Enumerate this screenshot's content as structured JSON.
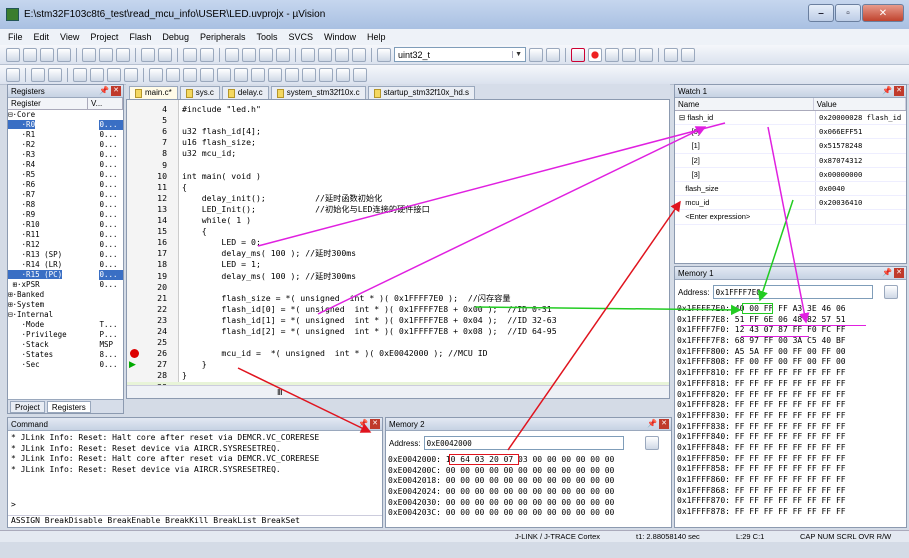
{
  "window": {
    "title": "E:\\stm32F103c8t6_test\\read_mcu_info\\USER\\LED.uvprojx - µVision",
    "min": "–",
    "max": "▫",
    "close": "✕"
  },
  "menu": [
    "File",
    "Edit",
    "View",
    "Project",
    "Flash",
    "Debug",
    "Peripherals",
    "Tools",
    "SVCS",
    "Window",
    "Help"
  ],
  "toolbar": {
    "target_combo": "uint32_t"
  },
  "registers": {
    "title": "Registers",
    "col_register": "Register",
    "col_value": "V...",
    "rows": [
      {
        "name": "⊟·Core",
        "value": ""
      },
      {
        "name": "   ·R0",
        "value": "0...",
        "sel": true
      },
      {
        "name": "   ·R1",
        "value": "0..."
      },
      {
        "name": "   ·R2",
        "value": "0..."
      },
      {
        "name": "   ·R3",
        "value": "0..."
      },
      {
        "name": "   ·R4",
        "value": "0..."
      },
      {
        "name": "   ·R5",
        "value": "0..."
      },
      {
        "name": "   ·R6",
        "value": "0..."
      },
      {
        "name": "   ·R7",
        "value": "0..."
      },
      {
        "name": "   ·R8",
        "value": "0..."
      },
      {
        "name": "   ·R9",
        "value": "0..."
      },
      {
        "name": "   ·R10",
        "value": "0..."
      },
      {
        "name": "   ·R11",
        "value": "0..."
      },
      {
        "name": "   ·R12",
        "value": "0..."
      },
      {
        "name": "   ·R13 (SP)",
        "value": "0..."
      },
      {
        "name": "   ·R14 (LR)",
        "value": "0..."
      },
      {
        "name": "   ·R15 (PC)",
        "value": "0...",
        "sel": true
      },
      {
        "name": " ⊞·xPSR",
        "value": "0..."
      },
      {
        "name": "⊞·Banked",
        "value": ""
      },
      {
        "name": "⊞·System",
        "value": ""
      },
      {
        "name": "⊟·Internal",
        "value": ""
      },
      {
        "name": "   ·Mode",
        "value": "T..."
      },
      {
        "name": "   ·Privilege",
        "value": "P..."
      },
      {
        "name": "   ·Stack",
        "value": "MSP"
      },
      {
        "name": "   ·States",
        "value": "8..."
      },
      {
        "name": "   ·Sec",
        "value": "0..."
      }
    ],
    "tab_project": "Project",
    "tab_registers": "Registers"
  },
  "editor": {
    "tabs": [
      "main.c*",
      "sys.c",
      "delay.c",
      "system_stm32f10x.c",
      "startup_stm32f10x_hd.s"
    ],
    "lines": [
      {
        "n": "4",
        "code": "#include \"led.h\""
      },
      {
        "n": "5",
        "code": ""
      },
      {
        "n": "6",
        "code": "u32 flash_id[4];"
      },
      {
        "n": "7",
        "code": "u16 flash_size;"
      },
      {
        "n": "8",
        "code": "u32 mcu_id;"
      },
      {
        "n": "9",
        "code": ""
      },
      {
        "n": "10",
        "code": "int main( void )"
      },
      {
        "n": "11",
        "code": "{"
      },
      {
        "n": "12",
        "code": "    delay_init();          //延时函数初始化"
      },
      {
        "n": "13",
        "code": "    LED_Init();            //初始化与LED连接的硬件接口"
      },
      {
        "n": "14",
        "code": "    while( 1 )"
      },
      {
        "n": "15",
        "code": "    {"
      },
      {
        "n": "16",
        "code": "        LED = 0;"
      },
      {
        "n": "17",
        "code": "        delay_ms( 100 ); //延时300ms"
      },
      {
        "n": "18",
        "code": "        LED = 1;"
      },
      {
        "n": "19",
        "code": "        delay_ms( 100 ); //延时300ms"
      },
      {
        "n": "20",
        "code": ""
      },
      {
        "n": "21",
        "code": "        flash_size = *( unsigned  int * )( 0x1FFFF7E0 );  //闪存容量"
      },
      {
        "n": "22",
        "code": "        flash_id[0] = *( unsigned  int * )( 0x1FFFF7E8 + 0x00 );  //ID 0-31"
      },
      {
        "n": "23",
        "code": "        flash_id[1] = *( unsigned  int * )( 0x1FFFF7E8 + 0x04 );  //ID 32-63"
      },
      {
        "n": "24",
        "code": "        flash_id[2] = *( unsigned  int * )( 0x1FFFF7E8 + 0x08 );  //ID 64-95"
      },
      {
        "n": "25",
        "code": ""
      },
      {
        "n": "26",
        "code": "        mcu_id =  *( unsigned  int * )( 0xE0042000 ); //MCU ID"
      },
      {
        "n": "27",
        "code": "    }"
      },
      {
        "n": "28",
        "code": "}"
      },
      {
        "n": "29",
        "code": ""
      }
    ]
  },
  "watch": {
    "title": "Watch 1",
    "col_name": "Name",
    "col_value": "Value",
    "rows": [
      {
        "name": "⊟ flash_id",
        "value": "0x20000028 flash_id"
      },
      {
        "name": "      [0]",
        "value": "0x066EFF51"
      },
      {
        "name": "      [1]",
        "value": "0x51578248"
      },
      {
        "name": "      [2]",
        "value": "0x87074312"
      },
      {
        "name": "      [3]",
        "value": "0x00000000"
      },
      {
        "name": "   flash_size",
        "value": "0x0040"
      },
      {
        "name": "   mcu_id",
        "value": "0x20036410"
      },
      {
        "name": "   <Enter expression>",
        "value": ""
      }
    ]
  },
  "memory1": {
    "title": "Memory 1",
    "addr_label": "Address:",
    "addr": "0x1FFFF7E0",
    "rows": [
      "0x1FFFF7E0: 40 00 FF FF A3 3E 46 06",
      "0x1FFFF7E8: 51 FF 6E 06 48 82 57 51",
      "0x1FFFF7F0: 12 43 07 87 FF F0 FC FF",
      "0x1FFFF7F8: 68 97 FF 00 3A C5 40 BF",
      "0x1FFFF800: A5 5A FF 00 FF 00 FF 00",
      "0x1FFFF808: FF 00 FF 00 FF 00 FF 00",
      "0x1FFFF810: FF FF FF FF FF FF FF FF",
      "0x1FFFF818: FF FF FF FF FF FF FF FF",
      "0x1FFFF820: FF FF FF FF FF FF FF FF",
      "0x1FFFF828: FF FF FF FF FF FF FF FF",
      "0x1FFFF830: FF FF FF FF FF FF FF FF",
      "0x1FFFF838: FF FF FF FF FF FF FF FF",
      "0x1FFFF840: FF FF FF FF FF FF FF FF",
      "0x1FFFF848: FF FF FF FF FF FF FF FF",
      "0x1FFFF850: FF FF FF FF FF FF FF FF",
      "0x1FFFF858: FF FF FF FF FF FF FF FF",
      "0x1FFFF860: FF FF FF FF FF FF FF FF",
      "0x1FFFF868: FF FF FF FF FF FF FF FF",
      "0x1FFFF870: FF FF FF FF FF FF FF FF",
      "0x1FFFF878: FF FF FF FF FF FF FF FF"
    ]
  },
  "memory2": {
    "title": "Memory 2",
    "addr_label": "Address:",
    "addr": "0xE0042000",
    "rows": [
      "0xE0042000: 10 64 03 20 07 03 00 00 00 00 00 00",
      "0xE004200C: 00 00 00 00 00 00 00 00 00 00 00 00",
      "0xE0042018: 00 00 00 00 00 00 00 00 00 00 00 00",
      "0xE0042024: 00 00 00 00 00 00 00 00 00 00 00 00",
      "0xE0042030: 00 00 00 00 00 00 00 00 00 00 00 00",
      "0xE004203C: 00 00 00 00 00 00 00 00 00 00 00 00"
    ]
  },
  "command": {
    "title": "Command",
    "lines": [
      "* JLink Info: Reset: Halt core after reset via DEMCR.VC_CORERESE",
      "* JLink Info: Reset: Reset device via AIRCR.SYSRESETREQ.",
      "* JLink Info: Reset: Halt core after reset via DEMCR.VC_CORERESE",
      "* JLink Info: Reset: Reset device via AIRCR.SYSRESETREQ."
    ],
    "prompt": ">",
    "hint": "ASSIGN BreakDisable BreakEnable BreakKill BreakList BreakSet"
  },
  "status": {
    "debugger": "J-LINK / J-TRACE Cortex",
    "time": "t1: 2.88058140 sec",
    "pos": "L:29 C:1",
    "flags": "CAP  NUM  SCRL  OVR  R/W"
  },
  "colors": {
    "annotation_red": "#e0141e",
    "annotation_magenta": "#e020e0",
    "annotation_green": "#22cc22"
  }
}
